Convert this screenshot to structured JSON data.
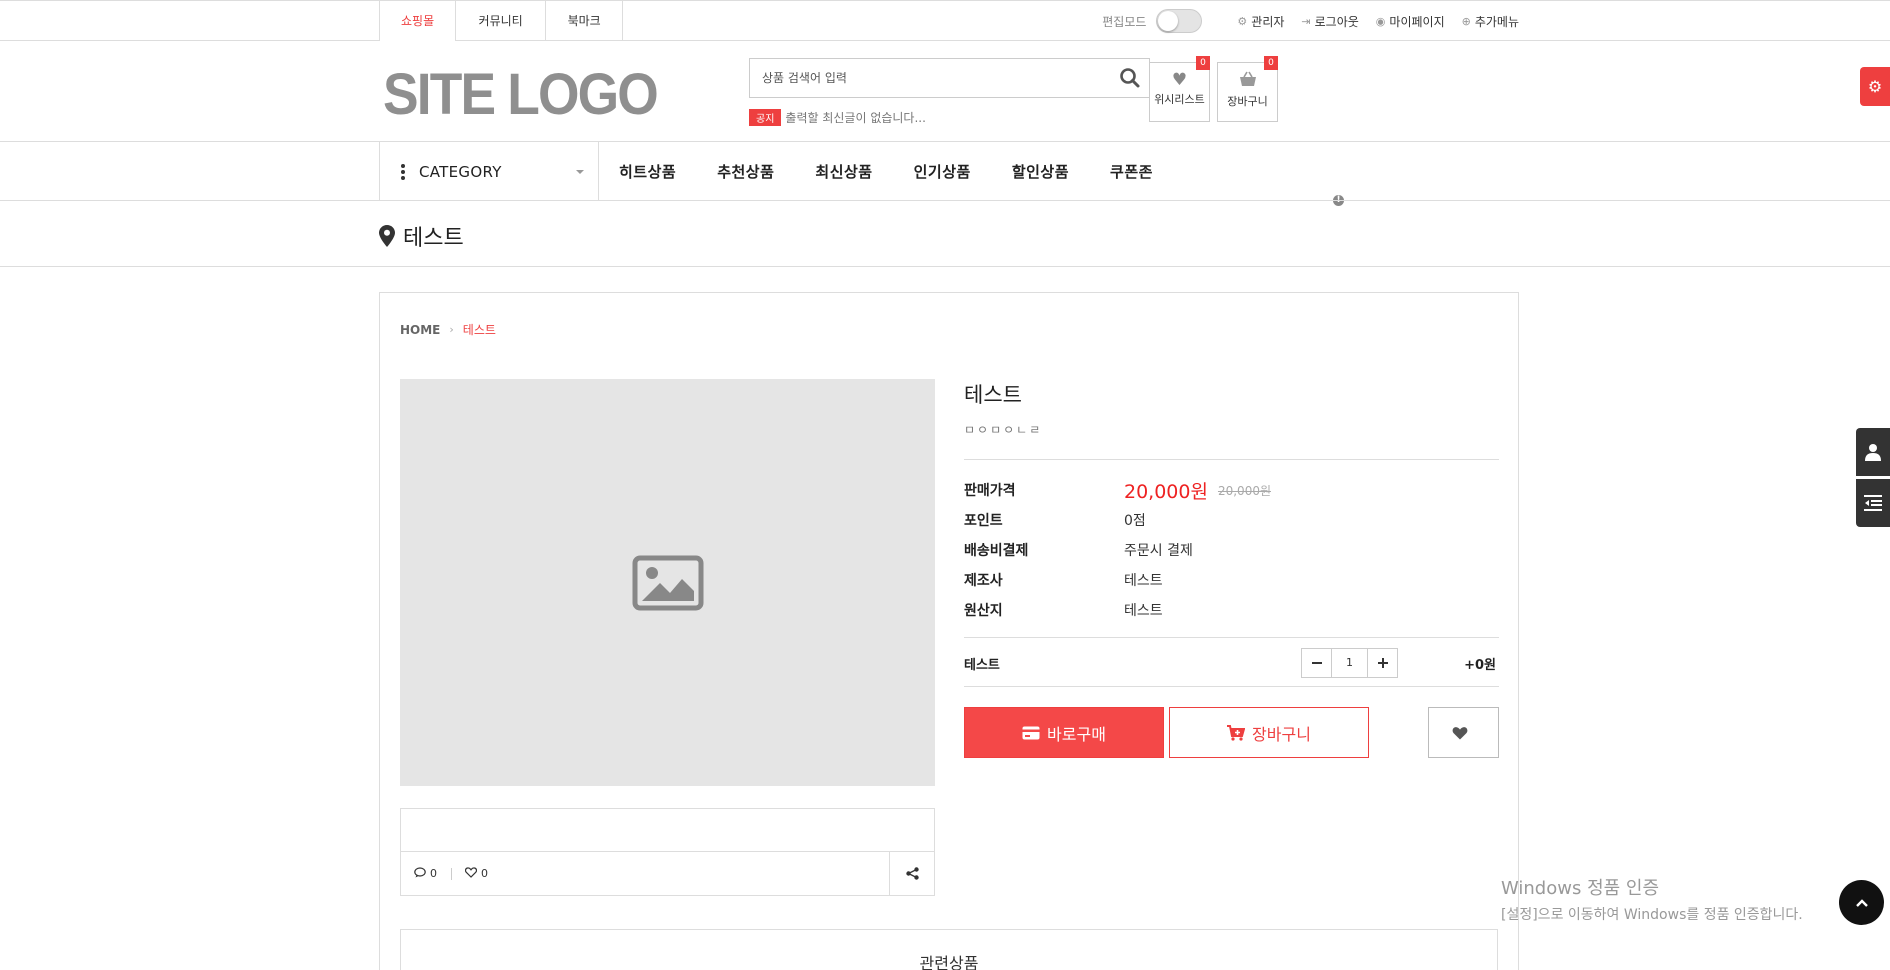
{
  "topbar": {
    "tabs": [
      "쇼핑몰",
      "커뮤니티",
      "북마크"
    ],
    "edit_mode_label": "편집모드",
    "edit_mode_on": false,
    "links": [
      "관리자",
      "로그아웃",
      "마이페이지",
      "추가메뉴"
    ]
  },
  "header": {
    "logo": "SITE LOGO",
    "search_placeholder": "상품 검색어 입력",
    "notice_badge": "공지",
    "notice_text": "출력할 최신글이 없습니다...",
    "wishlist_label": "위시리스트",
    "wishlist_count": "0",
    "cart_label": "장바구니",
    "cart_count": "0"
  },
  "nav": {
    "category_label": "CATEGORY",
    "items": [
      "히트상품",
      "추천상품",
      "최신상품",
      "인기상품",
      "할인상품",
      "쿠폰존"
    ]
  },
  "page_title": "테스트",
  "breadcrumb": {
    "home": "HOME",
    "current": "테스트"
  },
  "product": {
    "name": "테스트",
    "description": "ㅁㅇㅁㅇㄴㄹ",
    "price_label": "판매가격",
    "price": "20,000원",
    "original_price": "20,000원",
    "rows": [
      {
        "label": "포인트",
        "value": "0점"
      },
      {
        "label": "배송비결제",
        "value": "주문시 결제"
      },
      {
        "label": "제조사",
        "value": "테스트"
      },
      {
        "label": "원산지",
        "value": "테스트"
      }
    ],
    "option_label": "테스트",
    "quantity": "1",
    "option_price": "+0원",
    "comments_count": "0",
    "likes_count": "0"
  },
  "buttons": {
    "buy_now": "바로구매",
    "add_cart": "장바구니"
  },
  "related_title": "관련상품",
  "watermark": {
    "line1": "Windows 정품 인증",
    "line2": "[설정]으로 이동하여 Windows를 정품 인증합니다."
  },
  "colors": {
    "accent": "#ee3f3f",
    "logo_gray": "#8f8f8f",
    "image_placeholder": "#e5e5e5"
  }
}
